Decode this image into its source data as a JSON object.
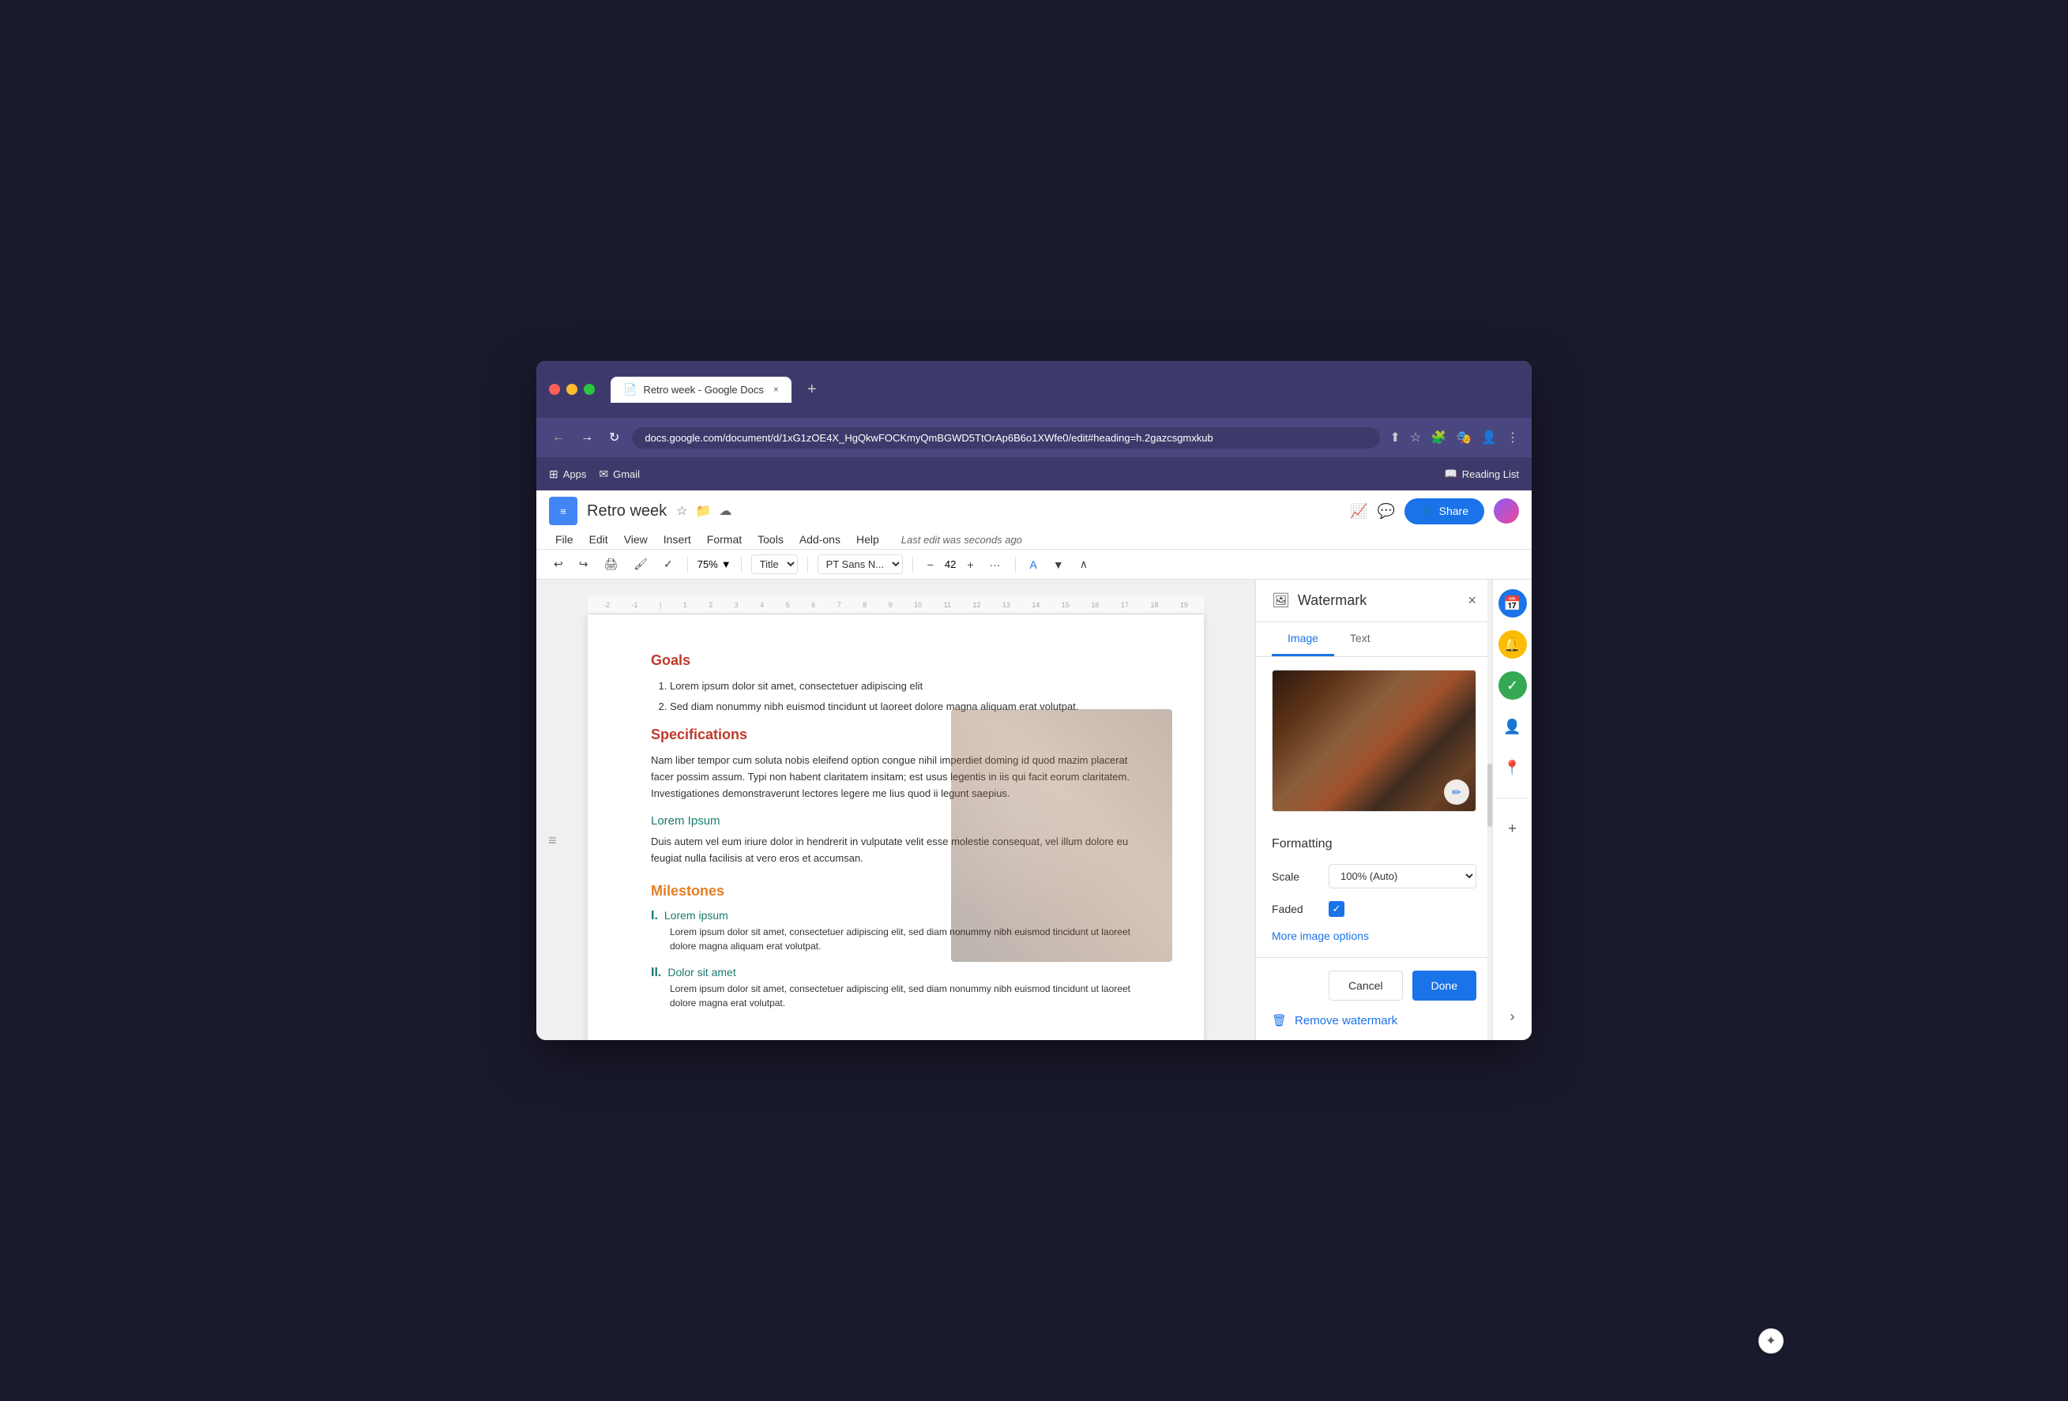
{
  "window": {
    "title": "Retro week - Google Docs",
    "url": "docs.google.com/document/d/1xG1zOE4X_HgQkwFOCKmyQmBGWD5TtOrAp6B6o1XWfe0/edit#heading=h.2gazcsgmxkub"
  },
  "browser": {
    "back_label": "←",
    "forward_label": "→",
    "refresh_label": "↻",
    "bookmarks": [
      {
        "label": "Apps",
        "icon": "⊞"
      },
      {
        "label": "Gmail",
        "icon": "✉"
      }
    ],
    "reading_list": "Reading List",
    "tab_plus": "+",
    "tab_close": "×"
  },
  "docs": {
    "title": "Retro week",
    "menu": [
      "File",
      "Edit",
      "View",
      "Insert",
      "Format",
      "Tools",
      "Add-ons",
      "Help"
    ],
    "last_edit": "Last edit was seconds ago",
    "share_label": "Share",
    "zoom": "75%",
    "style": "Title",
    "font": "PT Sans N...",
    "size": "42"
  },
  "toolbar": {
    "undo": "↩",
    "redo": "↪",
    "print": "🖨",
    "more": "..."
  },
  "document": {
    "goals_heading": "Goals",
    "goals_items": [
      "Lorem ipsum dolor sit amet, consectetuer adipiscing elit",
      "Sed diam nonummy nibh euismod tincidunt ut laoreet dolore magna aliquam erat volutpat."
    ],
    "specs_heading": "Specifications",
    "specs_text": "Nam liber tempor cum soluta nobis eleifend option congue nihil imperdiet doming id quod mazim placerat facer possim assum. Typi non habent claritatem insitam; est usus legentis in iis qui facit eorum claritatem. Investigationes demonstraverunt lectores legere me lius quod ii legunt saepius.",
    "lorem_subheading": "Lorem Ipsum",
    "lorem_text": "Duis autem vel eum iriure dolor in hendrerit in vulputate velit esse molestie consequat, vel illum dolore eu feugiat nulla facilisis at vero eros et accumsan.",
    "milestones_heading": "Milestones",
    "milestones": [
      {
        "num": "I.",
        "label": "Lorem ipsum",
        "text": "Lorem ipsum dolor sit amet, consectetuer adipiscing elit, sed diam nonummy nibh euismod tincidunt ut laoreet dolore magna aliquam erat volutpat."
      },
      {
        "num": "II.",
        "label": "Dolor sit amet",
        "text": "Lorem ipsum dolor sit amet, consectetuer adipiscing elit, sed diam nonummy nibh euismod tincidunt ut laoreet dolore magna erat volutpat."
      }
    ]
  },
  "watermark_panel": {
    "title": "Watermark",
    "close_label": "×",
    "tab_image": "Image",
    "tab_text": "Text",
    "formatting_title": "Formatting",
    "scale_label": "Scale",
    "scale_value": "100% (Auto)",
    "faded_label": "Faded",
    "faded_checked": true,
    "more_options": "More image options",
    "cancel_label": "Cancel",
    "done_label": "Done",
    "remove_label": "Remove watermark",
    "edit_icon": "✏"
  },
  "right_sidebar": {
    "icons": [
      "📅",
      "🔔",
      "✓",
      "👤",
      "📍",
      "+",
      "›"
    ]
  },
  "colors": {
    "heading_red": "#c0392b",
    "heading_orange": "#e67e22",
    "subheading_teal": "#1a7a6e",
    "blue": "#1a73e8",
    "purple_bar": "#3d3a6b"
  }
}
